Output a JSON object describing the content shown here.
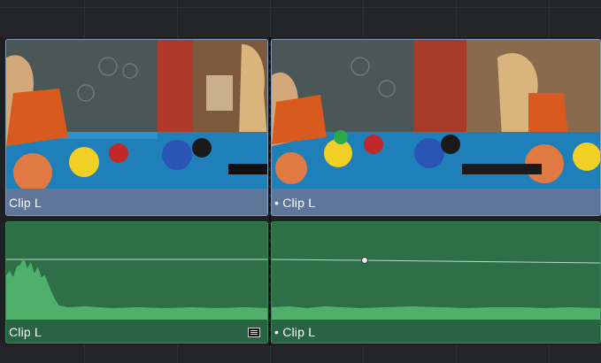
{
  "timeline": {
    "video_track": {
      "clips": [
        {
          "label": "Clip L"
        },
        {
          "label": "• Clip L"
        }
      ]
    },
    "audio_track": {
      "clips": [
        {
          "label": "Clip L",
          "has_menu_icon": true
        },
        {
          "label": "• Clip L",
          "has_menu_icon": false
        }
      ]
    },
    "colors": {
      "video_clip": "#5e7699",
      "audio_clip": "#2f6f48",
      "waveform": "#4fb06c",
      "background": "#1f2023"
    }
  }
}
